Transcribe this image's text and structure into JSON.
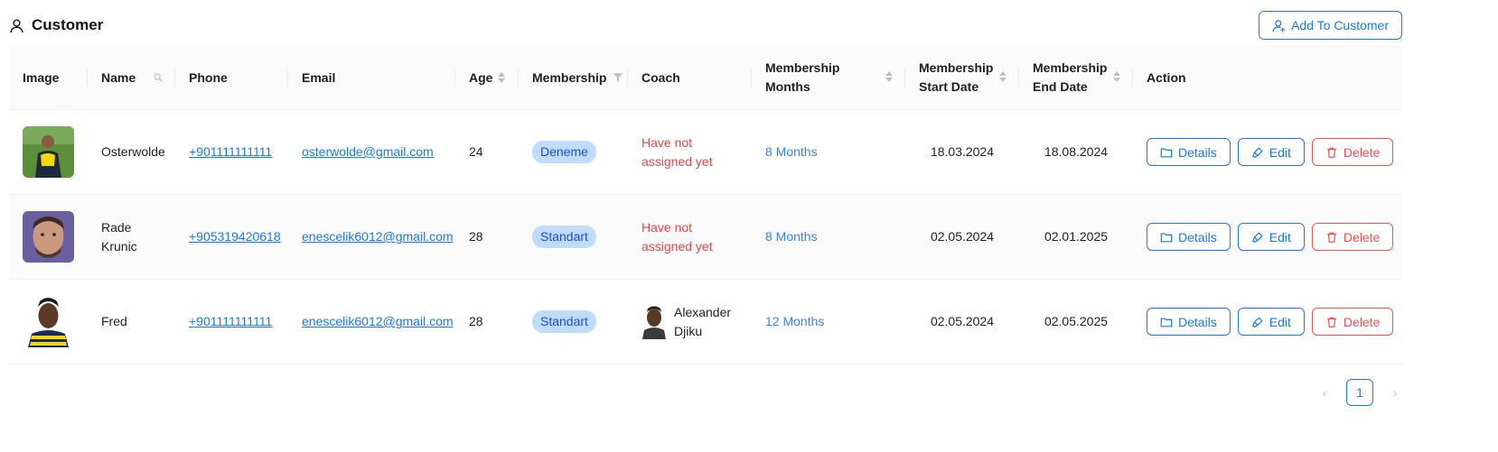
{
  "header": {
    "title": "Customer",
    "add_button": "Add To Customer"
  },
  "columns": {
    "image": "Image",
    "name": "Name",
    "phone": "Phone",
    "email": "Email",
    "age": "Age",
    "membership": "Membership",
    "coach": "Coach",
    "months": "Membership\nMonths",
    "start": "Membership\nStart Date",
    "end": "Membership\nEnd Date",
    "action": "Action"
  },
  "rows": [
    {
      "name": "Osterwolde",
      "phone": "+901111111111",
      "email": "osterwolde@gmail.com",
      "age": "24",
      "membership": "Deneme",
      "coach": "Have not\nassigned yet",
      "months": "8 Months",
      "start": "18.03.2024",
      "end": "18.08.2024"
    },
    {
      "name": "Rade\nKrunic",
      "phone": "+905319420618",
      "email": "enescelik6012@gmail.com",
      "age": "28",
      "membership": "Standart",
      "coach": "Have not\nassigned yet",
      "months": "8 Months",
      "start": "02.05.2024",
      "end": "02.01.2025"
    },
    {
      "name": "Fred",
      "phone": "+901111111111",
      "email": "enescelik6012@gmail.com",
      "age": "28",
      "membership": "Standart",
      "coach": "Alexander\nDjiku",
      "months": "12 Months",
      "start": "02.05.2024",
      "end": "02.05.2025"
    }
  ],
  "actions": {
    "details": "Details",
    "edit": "Edit",
    "delete": "Delete"
  },
  "pagination": {
    "current": "1",
    "prev": "‹",
    "next": "›"
  },
  "colors": {
    "primary": "#1677ff",
    "danger": "#ff4d4f",
    "tag_bg": "#bfdbfe",
    "warn": "#ef4444"
  },
  "icons": {
    "title": "user-icon",
    "add": "user-add-icon",
    "details": "folder-icon",
    "edit": "highlighter-icon",
    "delete": "trash-icon"
  }
}
